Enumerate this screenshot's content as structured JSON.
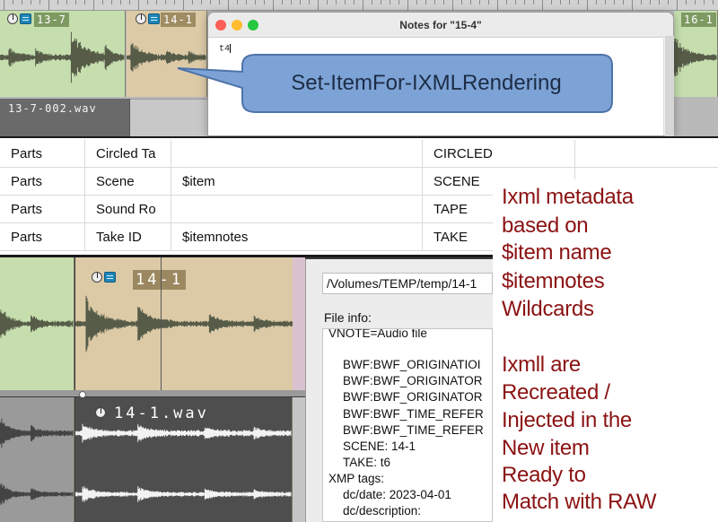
{
  "top_arrange": {
    "items": [
      {
        "label": "13-7"
      },
      {
        "label": "14-1"
      },
      {
        "label": "16-1"
      }
    ],
    "lower_item_label": "13-7-002.wav"
  },
  "notes_window": {
    "title": "Notes for \"15-4\"",
    "text": "t4"
  },
  "callout": {
    "text": "Set-ItemFor-IXMLRendering",
    "fill_color": "#7da3d6"
  },
  "metadata_table": {
    "rows": [
      [
        "Parts",
        "Circled Ta",
        "",
        "CIRCLED"
      ],
      [
        "Parts",
        "Scene",
        "$item",
        "SCENE"
      ],
      [
        "Parts",
        "Sound Ro",
        "",
        "TAPE"
      ],
      [
        "Parts",
        "Take ID",
        "$itemnotes",
        "TAKE"
      ]
    ]
  },
  "bottom_arrange": {
    "take_label": "14-1",
    "file_label": "14-1.wav"
  },
  "file_info": {
    "path": "/Volumes/TEMP/temp/14-1",
    "label": "File info:",
    "lines": [
      "VNOTE=Audio file",
      "",
      "BWF:BWF_ORIGINATIOI",
      "BWF:BWF_ORIGINATOR",
      "BWF:BWF_ORIGINATOR",
      "BWF:BWF_TIME_REFER",
      "BWF:BWF_TIME_REFER",
      "SCENE: 14-1",
      "TAKE: t6",
      "XMP tags:",
      "dc/date: 2023-04-01",
      "dc/description:"
    ]
  },
  "annotation": {
    "color": "#8b1212",
    "lines": [
      "Ixml metadata",
      "based on",
      "$item name",
      "$itemnotes",
      "Wildcards",
      "",
      "Ixmll are",
      "Recreated /",
      "Injected in the",
      "New item",
      "Ready to",
      "Match with RAW"
    ]
  },
  "colors": {
    "item_green": "#c6deae",
    "item_tan": "#dccaa7",
    "waveform": "#565c48",
    "selected_item": "#4e4e4e",
    "traffic_red": "#fe5f57",
    "traffic_yellow": "#febc2e",
    "traffic_green": "#28c840"
  }
}
